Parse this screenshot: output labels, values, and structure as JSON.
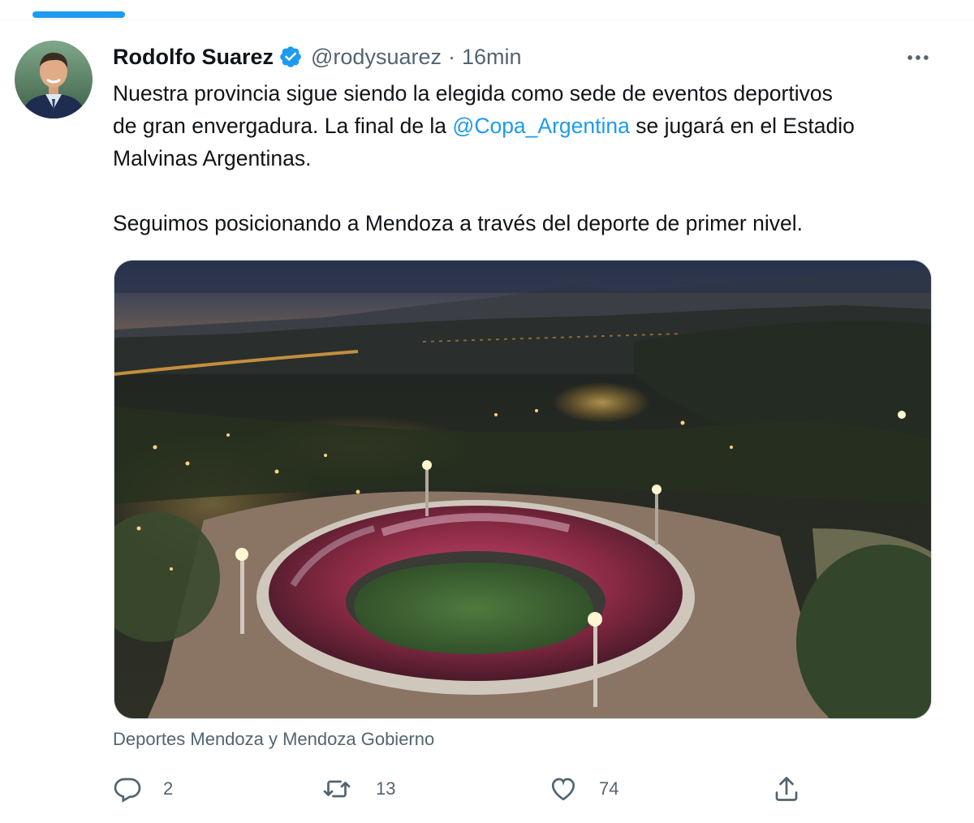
{
  "tweet": {
    "author": {
      "display_name": "Rodolfo Suarez",
      "handle": "@rodysuarez",
      "separator": "·",
      "time": "16min"
    },
    "text": {
      "line1": "Nuestra provincia sigue siendo la elegida como sede de eventos deportivos",
      "line2_before": "de gran envergadura. La final de la ",
      "mention": "@Copa_Argentina",
      "line2_after": " se jugará en el Estadio",
      "line3": "Malvinas Argentinas.",
      "paragraph2": "Seguimos posicionando a Mendoza a través del deporte de primer nivel."
    },
    "photo_credit": "Deportes Mendoza y Mendoza Gobierno",
    "actions": {
      "reply_count": "2",
      "retweet_count": "13",
      "like_count": "74"
    },
    "icons": {
      "verified": "verified-badge-icon",
      "more": "more-icon",
      "reply": "reply-icon",
      "retweet": "retweet-icon",
      "like": "heart-icon",
      "share": "share-icon"
    },
    "colors": {
      "accent": "#1d9bf0",
      "text": "#0f1419",
      "secondary": "#536471"
    }
  }
}
